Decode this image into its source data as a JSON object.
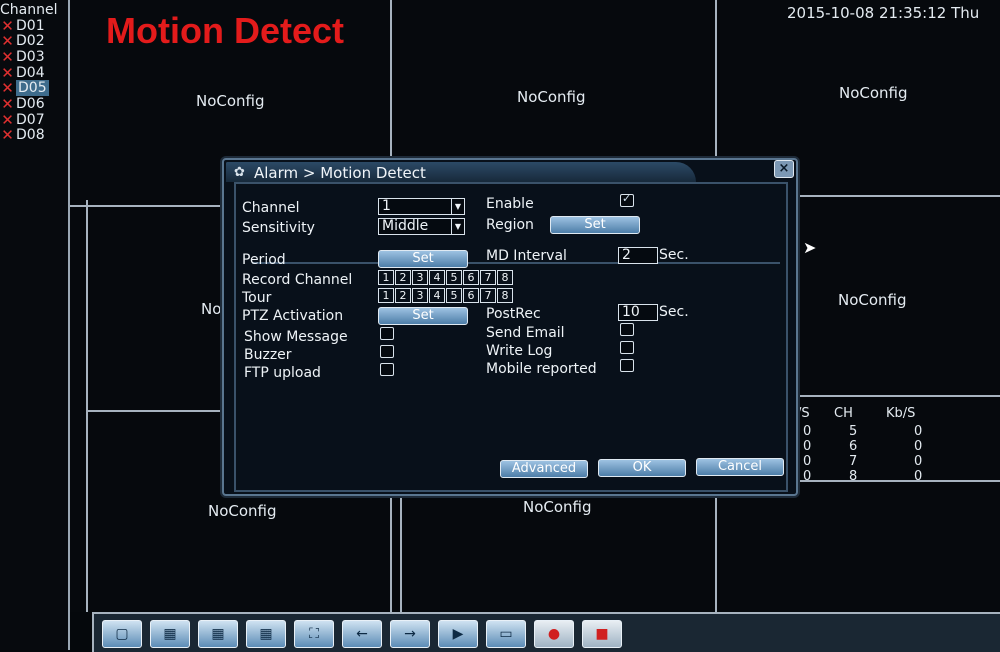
{
  "overlay": {
    "title": "Motion Detect",
    "datetime": "2015-10-08 21:35:12 Thu"
  },
  "channel_list": {
    "header": "Channel",
    "items": [
      {
        "label": "D01"
      },
      {
        "label": "D02"
      },
      {
        "label": "D03"
      },
      {
        "label": "D04"
      },
      {
        "label": "D05",
        "selected": true
      },
      {
        "label": "D06"
      },
      {
        "label": "D07"
      },
      {
        "label": "D08"
      }
    ]
  },
  "grid": {
    "noconfig_label": "NoConfig",
    "partial_label": "No"
  },
  "stats": {
    "headers": [
      "/S",
      "CH",
      "Kb/S"
    ],
    "rows": [
      [
        "0",
        "5",
        "0"
      ],
      [
        "0",
        "6",
        "0"
      ],
      [
        "0",
        "7",
        "0"
      ],
      [
        "0",
        "8",
        "0"
      ]
    ]
  },
  "dialog": {
    "title": "Alarm > Motion Detect",
    "close_label": "×",
    "channel_label": "Channel",
    "channel_value": "1",
    "enable_label": "Enable",
    "enable_checked": true,
    "sensitivity_label": "Sensitivity",
    "sensitivity_value": "Middle",
    "region_label": "Region",
    "set_label": "Set",
    "period_label": "Period",
    "md_interval_label": "MD Interval",
    "md_interval_value": "2",
    "sec_label": "Sec.",
    "record_channel_label": "Record Channel",
    "tour_label": "Tour",
    "channel_numbers": [
      "1",
      "2",
      "3",
      "4",
      "5",
      "6",
      "7",
      "8"
    ],
    "ptz_label": "PTZ Activation",
    "postrec_label": "PostRec",
    "postrec_value": "10",
    "show_message_label": "Show Message",
    "send_email_label": "Send Email",
    "buzzer_label": "Buzzer",
    "write_log_label": "Write Log",
    "ftp_label": "FTP upload",
    "mobile_label": "Mobile reported",
    "advanced_label": "Advanced",
    "ok_label": "OK",
    "cancel_label": "Cancel"
  },
  "toolbar": {
    "buttons": [
      {
        "name": "single-view-icon",
        "glyph": "▢"
      },
      {
        "name": "quad-view-icon",
        "glyph": "▦"
      },
      {
        "name": "nine-view-icon",
        "glyph": "▦"
      },
      {
        "name": "sixteen-view-icon",
        "glyph": "▦"
      },
      {
        "name": "fullscreen-icon",
        "glyph": "⛶"
      },
      {
        "name": "previous-icon",
        "glyph": "←"
      },
      {
        "name": "next-icon",
        "glyph": "→"
      },
      {
        "name": "playback-icon",
        "glyph": "▶"
      },
      {
        "name": "monitor-icon",
        "glyph": "▭"
      },
      {
        "name": "record-icon",
        "glyph": "●"
      },
      {
        "name": "stop-record-icon",
        "glyph": "■"
      }
    ]
  },
  "colors": {
    "title_red": "#e31b1b",
    "x_red": "#e03030",
    "button_blue": "#4d7ea8"
  }
}
